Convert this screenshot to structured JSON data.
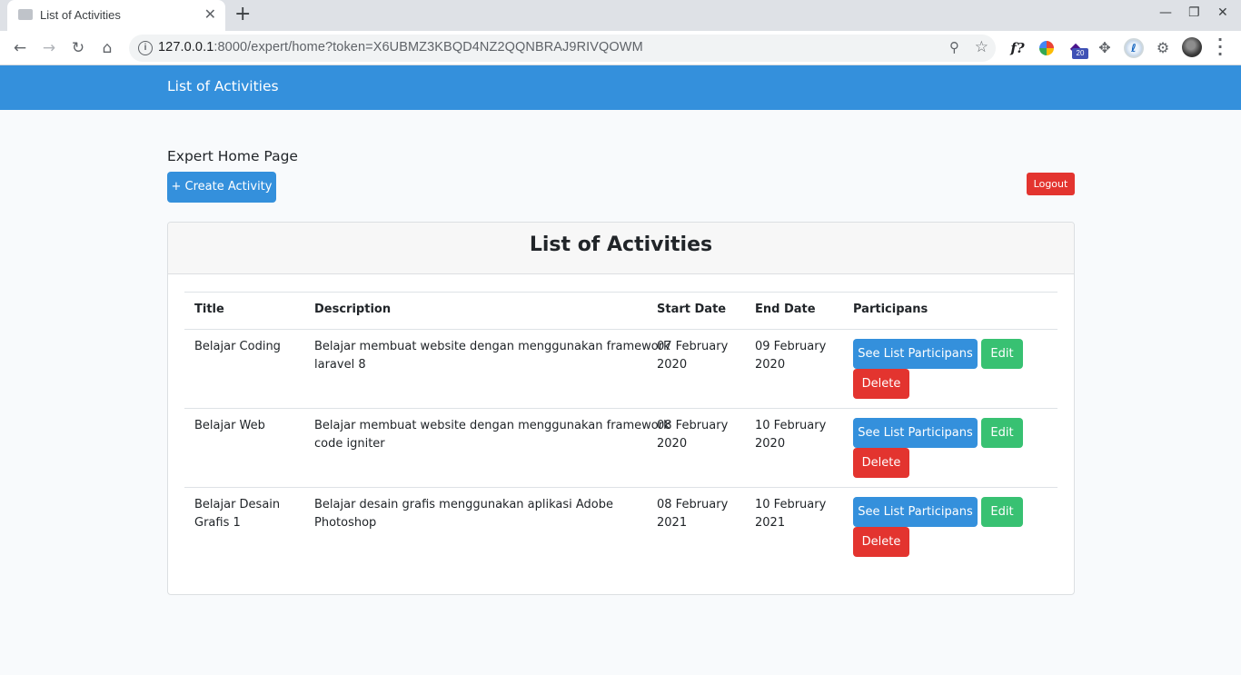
{
  "browser": {
    "tab_title": "List of Activities",
    "tab_close": "✕",
    "new_tab": "+",
    "url_host": "127.0.0.1",
    "url_rest": ":8000/expert/home?token=X6UBMZ3KBQD4NZ2QQNBRAJ9RIVQOWM",
    "extension_badge": "20",
    "ext_f_label": "f?",
    "win_min": "—",
    "win_max": "❐",
    "win_close": "✕"
  },
  "navbar": {
    "brand": "List of Activities",
    "color": "#3490dc"
  },
  "page": {
    "heading": "Expert Home Page",
    "create_button": "+ Create Activity",
    "logout_button": "Logout"
  },
  "card": {
    "title": "List of Activities"
  },
  "table": {
    "columns": [
      "Title",
      "Description",
      "Start Date",
      "End Date",
      "Participans"
    ],
    "rows": [
      {
        "title": [
          "Belajar Coding"
        ],
        "description": [
          "Belajar membuat website dengan menggunakan framework",
          "laravel 8"
        ],
        "start": [
          "07 February",
          "2020"
        ],
        "end": [
          "09 February",
          "2020"
        ]
      },
      {
        "title": [
          "Belajar Web"
        ],
        "description": [
          "Belajar membuat website dengan menggunakan framework",
          "code igniter"
        ],
        "start": [
          "08 February",
          "2020"
        ],
        "end": [
          "10 February",
          "2020"
        ]
      },
      {
        "title": [
          "Belajar Desain",
          "Grafis 1"
        ],
        "description": [
          "Belajar desain grafis menggunakan aplikasi Adobe",
          "Photoshop"
        ],
        "start": [
          "08 February",
          "2021"
        ],
        "end": [
          "10 February",
          "2021"
        ]
      }
    ],
    "actions": {
      "see": "See List Participans",
      "edit": "Edit",
      "delete": "Delete"
    }
  },
  "colors": {
    "primary": "#3490dc",
    "success": "#38c172",
    "danger": "#e3342f"
  }
}
